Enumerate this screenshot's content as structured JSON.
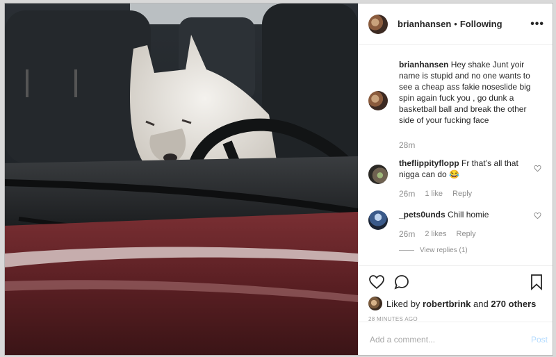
{
  "post": {
    "username": "brianhansen",
    "separator": "•",
    "follow_status": "Following",
    "more_icon": "ellipsis-icon"
  },
  "comments": [
    {
      "username": "brianhansen",
      "text": "Hey shake Junt yoir name is stupid and no one wants to see a cheap ass fakie noseslide big spin again fuck you , go dunk a basketball ball and break the other side of your fucking face",
      "time": "28m"
    },
    {
      "username": "theflippityflopp",
      "text": "Fr that’s all that nigga can do 😂",
      "time": "26m",
      "likes": "1 like",
      "reply": "Reply"
    },
    {
      "username": "_pets0unds",
      "text": "Chill homie",
      "time": "26m",
      "likes": "2 likes",
      "reply": "Reply",
      "view_replies": "View replies (1)"
    }
  ],
  "actions": {
    "like_icon": "heart-icon",
    "comment_icon": "comment-icon",
    "save_icon": "bookmark-icon",
    "liked_by_prefix": "Liked by",
    "liked_by_user": "robertbrink",
    "liked_by_and": "and",
    "liked_by_others": "270 others",
    "timestamp": "28 MINUTES AGO"
  },
  "composer": {
    "placeholder": "Add a comment...",
    "post_label": "Post"
  },
  "colors": {
    "text": "#262626",
    "muted": "#8e8e8e",
    "post_disabled": "#b3dbff",
    "divider": "#efefef"
  }
}
